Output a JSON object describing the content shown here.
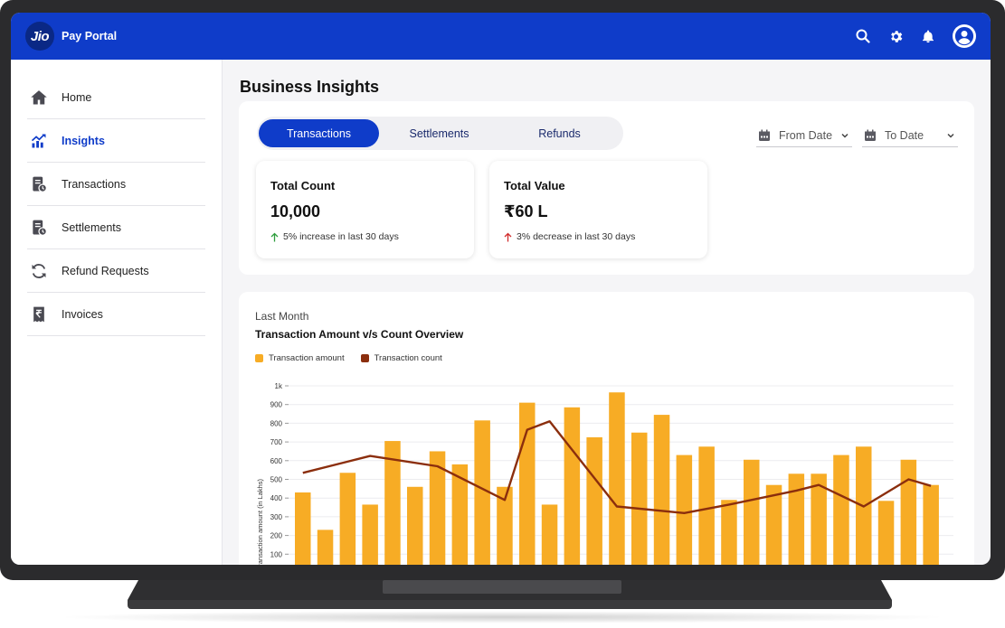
{
  "header": {
    "logo_text": "Jio",
    "app_name": "Pay Portal"
  },
  "sidebar": {
    "items": [
      {
        "label": "Home",
        "icon": "home-icon",
        "active": false
      },
      {
        "label": "Insights",
        "icon": "insights-icon",
        "active": true
      },
      {
        "label": "Transactions",
        "icon": "transactions-icon",
        "active": false
      },
      {
        "label": "Settlements",
        "icon": "settlements-icon",
        "active": false
      },
      {
        "label": "Refund Requests",
        "icon": "refund-icon",
        "active": false
      },
      {
        "label": "Invoices",
        "icon": "rupee-invoice-icon",
        "active": false
      }
    ]
  },
  "page": {
    "title": "Business Insights"
  },
  "tabs": [
    {
      "label": "Transactions",
      "active": true
    },
    {
      "label": "Settlements",
      "active": false
    },
    {
      "label": "Refunds",
      "active": false
    }
  ],
  "filters": {
    "from_date": "From Date",
    "to_date": "To Date"
  },
  "stats": {
    "total_count": {
      "title": "Total Count",
      "value": "10,000",
      "note": "5% increase in last 30 days",
      "trend": "up",
      "color": "#2e9e3e"
    },
    "total_value": {
      "title": "Total Value",
      "value": "₹60 L",
      "note": "3% decrease in last 30 days",
      "trend": "down",
      "color": "#d12b2b"
    }
  },
  "chart": {
    "subtitle": "Last Month",
    "title": "Transaction Amount v/s Count Overview"
  },
  "chart_data": {
    "type": "bar",
    "ylabel": "Transaction amount (in Lakhs)",
    "y_ticks": [
      "100",
      "200",
      "300",
      "400",
      "500",
      "600",
      "700",
      "800",
      "900",
      "1k"
    ],
    "ylim": [
      0,
      1000
    ],
    "grid": true,
    "legend_position": "top-left",
    "series": [
      {
        "name": "Transaction amount",
        "kind": "bar",
        "color": "#f7ac25",
        "values": [
          430,
          230,
          535,
          365,
          705,
          460,
          650,
          580,
          815,
          460,
          910,
          365,
          885,
          725,
          965,
          750,
          845,
          630,
          675,
          390,
          605,
          470,
          530,
          530,
          630,
          675,
          385,
          605,
          470
        ]
      },
      {
        "name": "Transaction count",
        "kind": "line",
        "color": "#8b2e0d",
        "points": [
          [
            0,
            535
          ],
          [
            3,
            625
          ],
          [
            6,
            570
          ],
          [
            9,
            390
          ],
          [
            10,
            765
          ],
          [
            11,
            810
          ],
          [
            14,
            355
          ],
          [
            17,
            320
          ],
          [
            19,
            365
          ],
          [
            22,
            440
          ],
          [
            23,
            470
          ],
          [
            25,
            355
          ],
          [
            27,
            500
          ],
          [
            28,
            465
          ]
        ]
      }
    ]
  },
  "colors": {
    "brand_blue": "#0f3cc9",
    "bar": "#f7ac25",
    "line": "#8b2e0d"
  }
}
